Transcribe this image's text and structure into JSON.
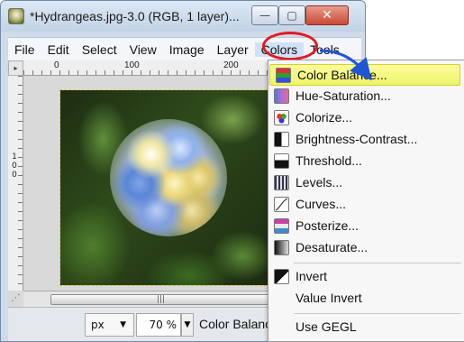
{
  "window": {
    "title": "*Hydrangeas.jpg-3.0 (RGB, 1 layer)...",
    "controls": {
      "minimize": "—",
      "maximize": "▢",
      "close": "✕"
    }
  },
  "menubar": {
    "items": [
      "File",
      "Edit",
      "Select",
      "View",
      "Image",
      "Layer",
      "Colors",
      "Tools"
    ]
  },
  "rulers": {
    "corner": "▸",
    "h_labels": [
      "0",
      "100",
      "200"
    ],
    "v_labels": [
      "1",
      "0",
      "0"
    ]
  },
  "statusbar": {
    "unit": "px",
    "zoom": "70 %",
    "message": "Color Balance..."
  },
  "colors_menu": {
    "items": [
      {
        "label": "Color Balance...",
        "icon": "color-balance-icon",
        "highlighted": true
      },
      {
        "label": "Hue-Saturation...",
        "icon": "hue-saturation-icon"
      },
      {
        "label": "Colorize...",
        "icon": "colorize-icon"
      },
      {
        "label": "Brightness-Contrast...",
        "icon": "brightness-contrast-icon"
      },
      {
        "label": "Threshold...",
        "icon": "threshold-icon"
      },
      {
        "label": "Levels...",
        "icon": "levels-icon"
      },
      {
        "label": "Curves...",
        "icon": "curves-icon"
      },
      {
        "label": "Posterize...",
        "icon": "posterize-icon"
      },
      {
        "label": "Desaturate...",
        "icon": "desaturate-icon"
      },
      {
        "label": "Invert",
        "icon": "invert-icon"
      },
      {
        "label": "Value Invert",
        "icon": ""
      },
      {
        "label": "Use GEGL",
        "icon": ""
      }
    ]
  },
  "colors": {
    "annotation_circle": "#e21b23",
    "annotation_arrow": "#1f56d6",
    "highlight": "#eef46a"
  }
}
